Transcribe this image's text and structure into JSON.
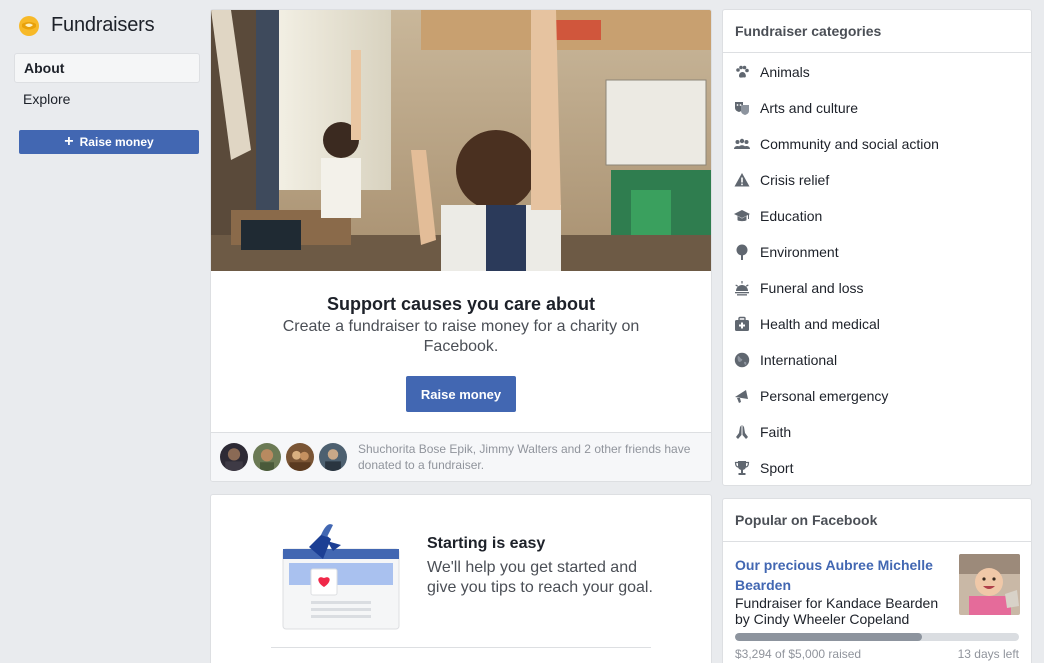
{
  "app": {
    "title": "Fundraisers"
  },
  "nav": {
    "items": [
      {
        "label": "About",
        "active": true
      },
      {
        "label": "Explore",
        "active": false
      }
    ],
    "raise_button": "Raise money"
  },
  "hero": {
    "title": "Support causes you care about",
    "subtitle": "Create a fundraiser to raise money for a charity on Facebook.",
    "button": "Raise money",
    "friends_text": "Shuchorita Bose Epik, Jimmy Walters and 2 other friends have donated to a fundraiser."
  },
  "starting": {
    "title": "Starting is easy",
    "description": "We'll help you get started and give you tips to reach your goal."
  },
  "categories": {
    "heading": "Fundraiser categories",
    "items": [
      {
        "label": "Animals",
        "icon": "paw-icon"
      },
      {
        "label": "Arts and culture",
        "icon": "theater-masks-icon"
      },
      {
        "label": "Community and social action",
        "icon": "people-group-icon"
      },
      {
        "label": "Crisis relief",
        "icon": "warning-triangle-icon"
      },
      {
        "label": "Education",
        "icon": "graduation-cap-icon"
      },
      {
        "label": "Environment",
        "icon": "tree-icon"
      },
      {
        "label": "Funeral and loss",
        "icon": "sunset-icon"
      },
      {
        "label": "Health and medical",
        "icon": "medical-kit-icon"
      },
      {
        "label": "International",
        "icon": "globe-icon"
      },
      {
        "label": "Personal emergency",
        "icon": "megaphone-icon"
      },
      {
        "label": "Faith",
        "icon": "praying-hands-icon"
      },
      {
        "label": "Sport",
        "icon": "trophy-icon"
      }
    ]
  },
  "popular": {
    "heading": "Popular on Facebook",
    "title": "Our precious Aubree Michelle Bearden",
    "description": "Fundraiser for Kandace Bearden by Cindy Wheeler Copeland",
    "raised_text": "$3,294 of $5,000 raised",
    "days_left": "13 days left",
    "progress_fraction": 0.659
  },
  "colors": {
    "brand_blue": "#4267b2",
    "link_blue": "#4267b2",
    "background": "#e9ebee",
    "icon_gray": "#606770"
  }
}
